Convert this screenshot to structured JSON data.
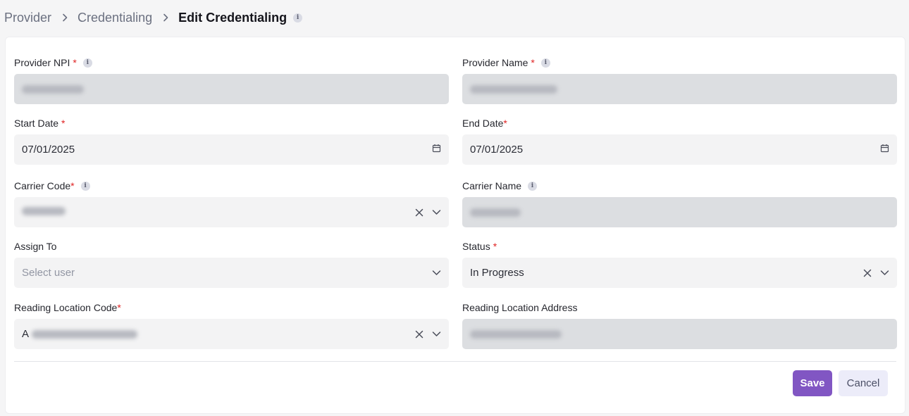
{
  "breadcrumb": {
    "items": [
      "Provider",
      "Credentialing"
    ],
    "current": "Edit Credentialing"
  },
  "form": {
    "provider_npi": {
      "label": "Provider NPI",
      "required": "*"
    },
    "provider_name": {
      "label": "Provider Name",
      "required": "*"
    },
    "start_date": {
      "label": "Start Date",
      "required": "*",
      "value": "07/01/2025"
    },
    "end_date": {
      "label": "End Date",
      "required": "*",
      "value": "07/01/2025"
    },
    "carrier_code": {
      "label": "Carrier Code",
      "required": "*"
    },
    "carrier_name": {
      "label": "Carrier Name"
    },
    "assign_to": {
      "label": "Assign To",
      "placeholder": "Select user"
    },
    "status": {
      "label": "Status",
      "required": "*",
      "value": "In Progress"
    },
    "reading_location_code": {
      "label": "Reading Location Code",
      "required": "*",
      "value_prefix": "A"
    },
    "reading_location_address": {
      "label": "Reading Location Address"
    }
  },
  "actions": {
    "save_label": "Save",
    "cancel_label": "Cancel"
  },
  "icons": {
    "info": "i"
  },
  "colors": {
    "accent": "#8156c3",
    "required": "#e02424",
    "disabled_field": "#dcdee1",
    "field": "#f3f3f4"
  }
}
